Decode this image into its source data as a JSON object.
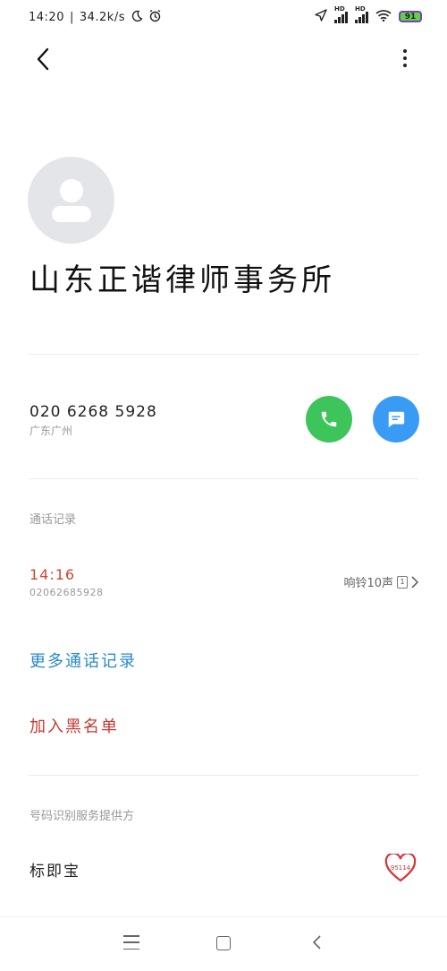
{
  "status_bar": {
    "time": "14:20",
    "speed": "34.2k/s",
    "signal_label_1": "HD",
    "signal_label_2": "HD",
    "battery_level": "91",
    "icons": [
      "moon-icon",
      "alarm-icon",
      "location-icon",
      "signal-icon",
      "signal-icon",
      "wifi-icon",
      "battery-icon"
    ]
  },
  "contact": {
    "name": "山东正谐律师事务所",
    "phone": "020 6268 5928",
    "location": "广东广州"
  },
  "call_log": {
    "section_title": "通话记录",
    "entries": [
      {
        "time": "14:16",
        "number": "02062685928",
        "detail": "响铃10声",
        "sim": "1"
      }
    ],
    "more_label": "更多通话记录"
  },
  "actions": {
    "blacklist_label": "加入黑名单"
  },
  "provider": {
    "section_title": "号码识别服务提供方",
    "name": "标即宝",
    "logo_text": "95114"
  },
  "colors": {
    "call_button": "#3dc45a",
    "message_button": "#3a9bf5",
    "call_time": "#d0462f",
    "more_link": "#2a8ac7",
    "blacklist": "#c8382e"
  }
}
